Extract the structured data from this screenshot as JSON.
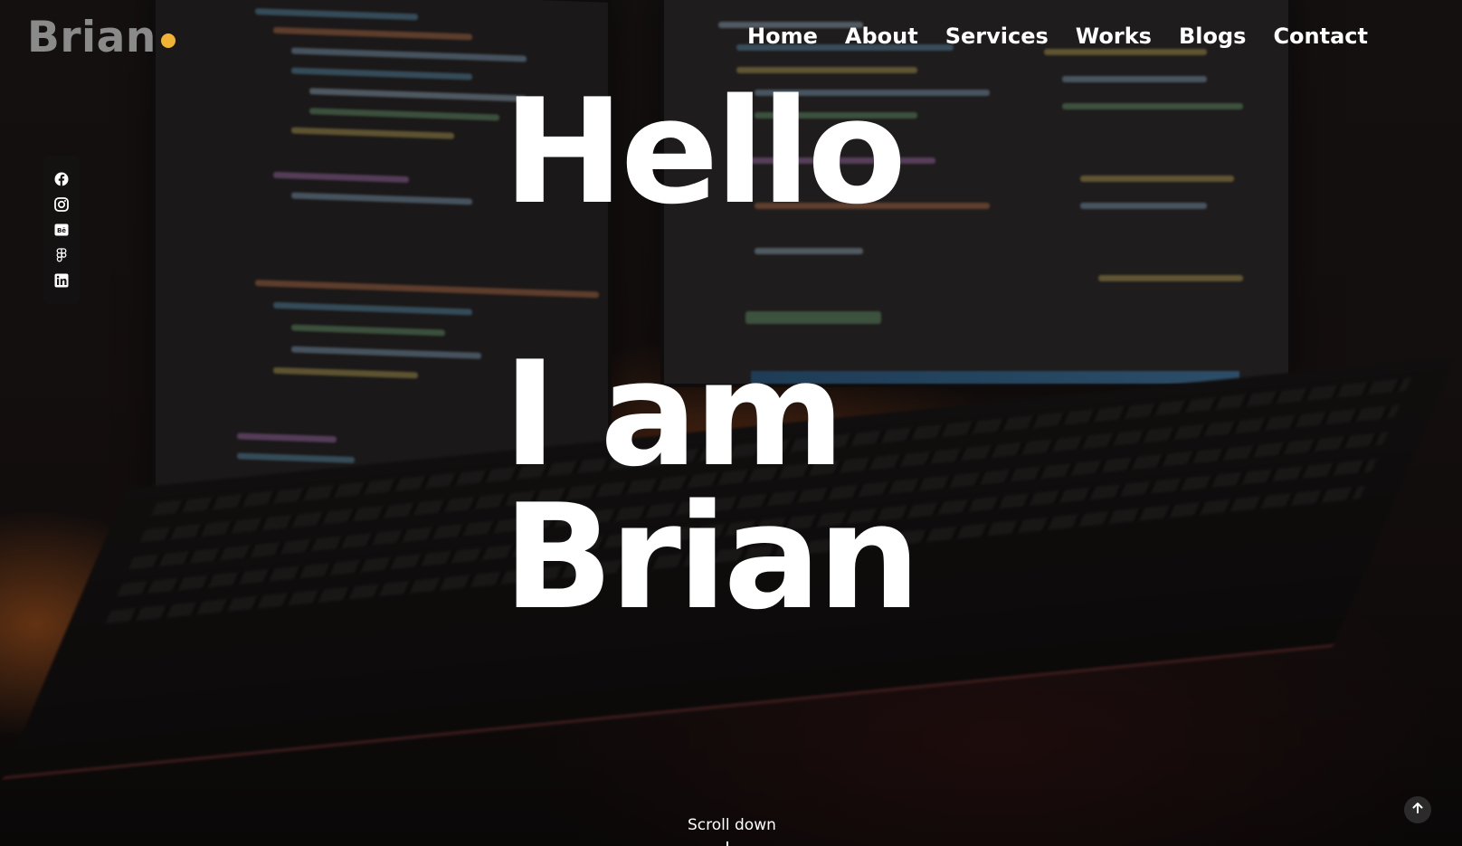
{
  "brand": {
    "name": "Brian",
    "dot_color": "#f2b233"
  },
  "nav": {
    "items": [
      {
        "label": "Home"
      },
      {
        "label": "About"
      },
      {
        "label": "Services"
      },
      {
        "label": "Works"
      },
      {
        "label": "Blogs"
      },
      {
        "label": "Contact"
      }
    ]
  },
  "social": {
    "icons": [
      "facebook-icon",
      "instagram-icon",
      "behance-icon",
      "figma-icon",
      "linkedin-icon"
    ]
  },
  "hero": {
    "line1": "Hello",
    "line2": "I am",
    "line3": "Brian"
  },
  "scroll": {
    "label": "Scroll down"
  },
  "back_to_top": {
    "icon": "arrow-up-icon"
  },
  "colors": {
    "accent": "#f2b233",
    "text": "#ffffff",
    "logo_text": "#8a8a8a"
  }
}
